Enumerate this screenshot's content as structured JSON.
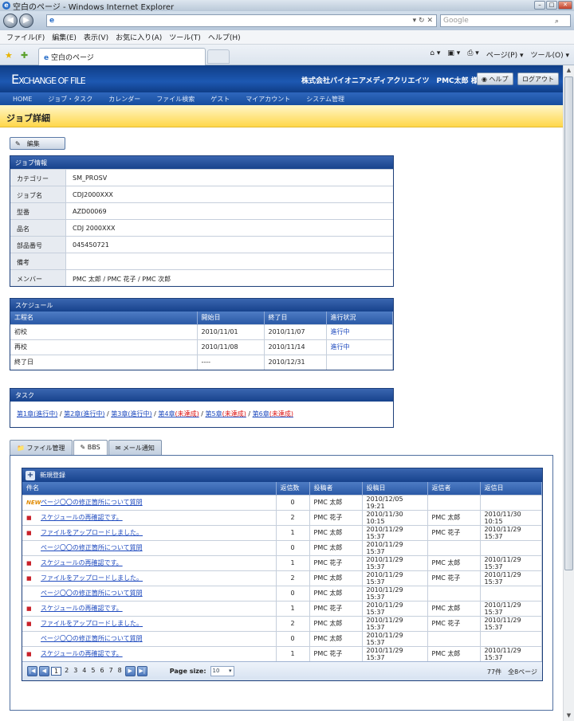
{
  "browser": {
    "window_title": "空白のページ - Windows Internet Explorer",
    "url_value": "",
    "search_placeholder": "Google",
    "menu": [
      "ファイル(F)",
      "編集(E)",
      "表示(V)",
      "お気に入り(A)",
      "ツール(T)",
      "ヘルプ(H)"
    ],
    "tab_title": "空白のページ",
    "tools": [
      "ページ(P) ▾",
      "ツール(O) ▾"
    ]
  },
  "app": {
    "logo_main": "E",
    "logo_rest": "XCHANGE OF FILE",
    "company_user": "株式会社パイオニアメディアクリエイツ　PMC太郎 様",
    "help": "ヘルプ",
    "logout": "ログアウト",
    "nav": [
      "HOME",
      "ジョブ・タスク",
      "カレンダー",
      "ファイル検索",
      "ゲスト",
      "マイアカウント",
      "システム管理"
    ],
    "page_title": "ジョブ詳細",
    "edit_label": "編集"
  },
  "job_info": {
    "title": "ジョブ情報",
    "rows": [
      {
        "k": "カテゴリー",
        "v": "SM_PROSV"
      },
      {
        "k": "ジョブ名",
        "v": "CDJ2000XXX"
      },
      {
        "k": "型番",
        "v": "AZD00069"
      },
      {
        "k": "品名",
        "v": "CDJ 2000XXX"
      },
      {
        "k": "部品番号",
        "v": "045450721"
      },
      {
        "k": "備考",
        "v": ""
      },
      {
        "k": "メンバー",
        "v": "PMC 太郎 / PMC 花子 / PMC 次郎"
      }
    ]
  },
  "schedule": {
    "title": "スケジュール",
    "headers": [
      "工程名",
      "開始日",
      "終了日",
      "進行状況"
    ],
    "rows": [
      [
        "初校",
        "2010/11/01",
        "2010/11/07",
        "進行中"
      ],
      [
        "再校",
        "2010/11/08",
        "2010/11/14",
        "進行中"
      ],
      [
        "終了日",
        "----",
        "2010/12/31",
        ""
      ]
    ]
  },
  "tasks": {
    "title": "タスク",
    "items": [
      {
        "name": "第1章",
        "status": "(進行中)",
        "done": false
      },
      {
        "name": "第2章",
        "status": "(進行中)",
        "done": false
      },
      {
        "name": "第3章",
        "status": "(進行中)",
        "done": false
      },
      {
        "name": "第4章",
        "status": "(未達成)",
        "done": true
      },
      {
        "name": "第5章",
        "status": "(未達成)",
        "done": true
      },
      {
        "name": "第6章",
        "status": "(未達成)",
        "done": true
      }
    ]
  },
  "tabs": [
    "ファイル管理",
    "BBS",
    "メール通知"
  ],
  "bbs": {
    "new_label": "新規登録",
    "headers": [
      "件名",
      "返信数",
      "投稿者",
      "投稿日",
      "返信者",
      "返信日"
    ],
    "rows": [
      {
        "icon": "new",
        "subject": "ページ〇〇の修正箇所について質問",
        "replies": "0",
        "poster": "PMC 太郎",
        "posted": "2010/12/05 19:21",
        "replier": "",
        "replied": ""
      },
      {
        "icon": "folder",
        "subject": "スケジュールの再確認です。",
        "replies": "2",
        "poster": "PMC 花子",
        "posted": "2010/11/30 10:15",
        "replier": "PMC 太郎",
        "replied": "2010/11/30 10:15"
      },
      {
        "icon": "folder",
        "subject": "ファイルをアップロードしました。",
        "replies": "1",
        "poster": "PMC 太郎",
        "posted": "2010/11/29 15:37",
        "replier": "PMC 花子",
        "replied": "2010/11/29 15:37"
      },
      {
        "icon": "",
        "subject": "ページ〇〇の修正箇所について質問",
        "replies": "0",
        "poster": "PMC 太郎",
        "posted": "2010/11/29 15:37",
        "replier": "",
        "replied": ""
      },
      {
        "icon": "folder",
        "subject": "スケジュールの再確認です。",
        "replies": "1",
        "poster": "PMC 花子",
        "posted": "2010/11/29 15:37",
        "replier": "PMC 太郎",
        "replied": "2010/11/29 15:37"
      },
      {
        "icon": "folder",
        "subject": "ファイルをアップロードしました。",
        "replies": "2",
        "poster": "PMC 太郎",
        "posted": "2010/11/29 15:37",
        "replier": "PMC 花子",
        "replied": "2010/11/29 15:37"
      },
      {
        "icon": "",
        "subject": "ページ〇〇の修正箇所について質問",
        "replies": "0",
        "poster": "PMC 太郎",
        "posted": "2010/11/29 15:37",
        "replier": "",
        "replied": ""
      },
      {
        "icon": "folder",
        "subject": "スケジュールの再確認です。",
        "replies": "1",
        "poster": "PMC 花子",
        "posted": "2010/11/29 15:37",
        "replier": "PMC 太郎",
        "replied": "2010/11/29 15:37"
      },
      {
        "icon": "folder",
        "subject": "ファイルをアップロードしました。",
        "replies": "2",
        "poster": "PMC 太郎",
        "posted": "2010/11/29 15:37",
        "replier": "PMC 花子",
        "replied": "2010/11/29 15:37"
      },
      {
        "icon": "",
        "subject": "ページ〇〇の修正箇所について質問",
        "replies": "0",
        "poster": "PMC 太郎",
        "posted": "2010/11/29 15:37",
        "replier": "",
        "replied": ""
      },
      {
        "icon": "folder",
        "subject": "スケジュールの再確認です。",
        "replies": "1",
        "poster": "PMC 花子",
        "posted": "2010/11/29 15:37",
        "replier": "PMC 太郎",
        "replied": "2010/11/29 15:37"
      }
    ],
    "pager": {
      "pages": [
        "1",
        "2",
        "3",
        "4",
        "5",
        "6",
        "7",
        "8"
      ],
      "current": "1",
      "size_label": "Page size:",
      "size_value": "10",
      "info": "77件　全8ページ"
    }
  },
  "colors": {
    "header_blue": "#1d58b2",
    "title_yellow": "#ffd74a",
    "link": "#1f4bbf",
    "incomplete": "#dd1111"
  }
}
